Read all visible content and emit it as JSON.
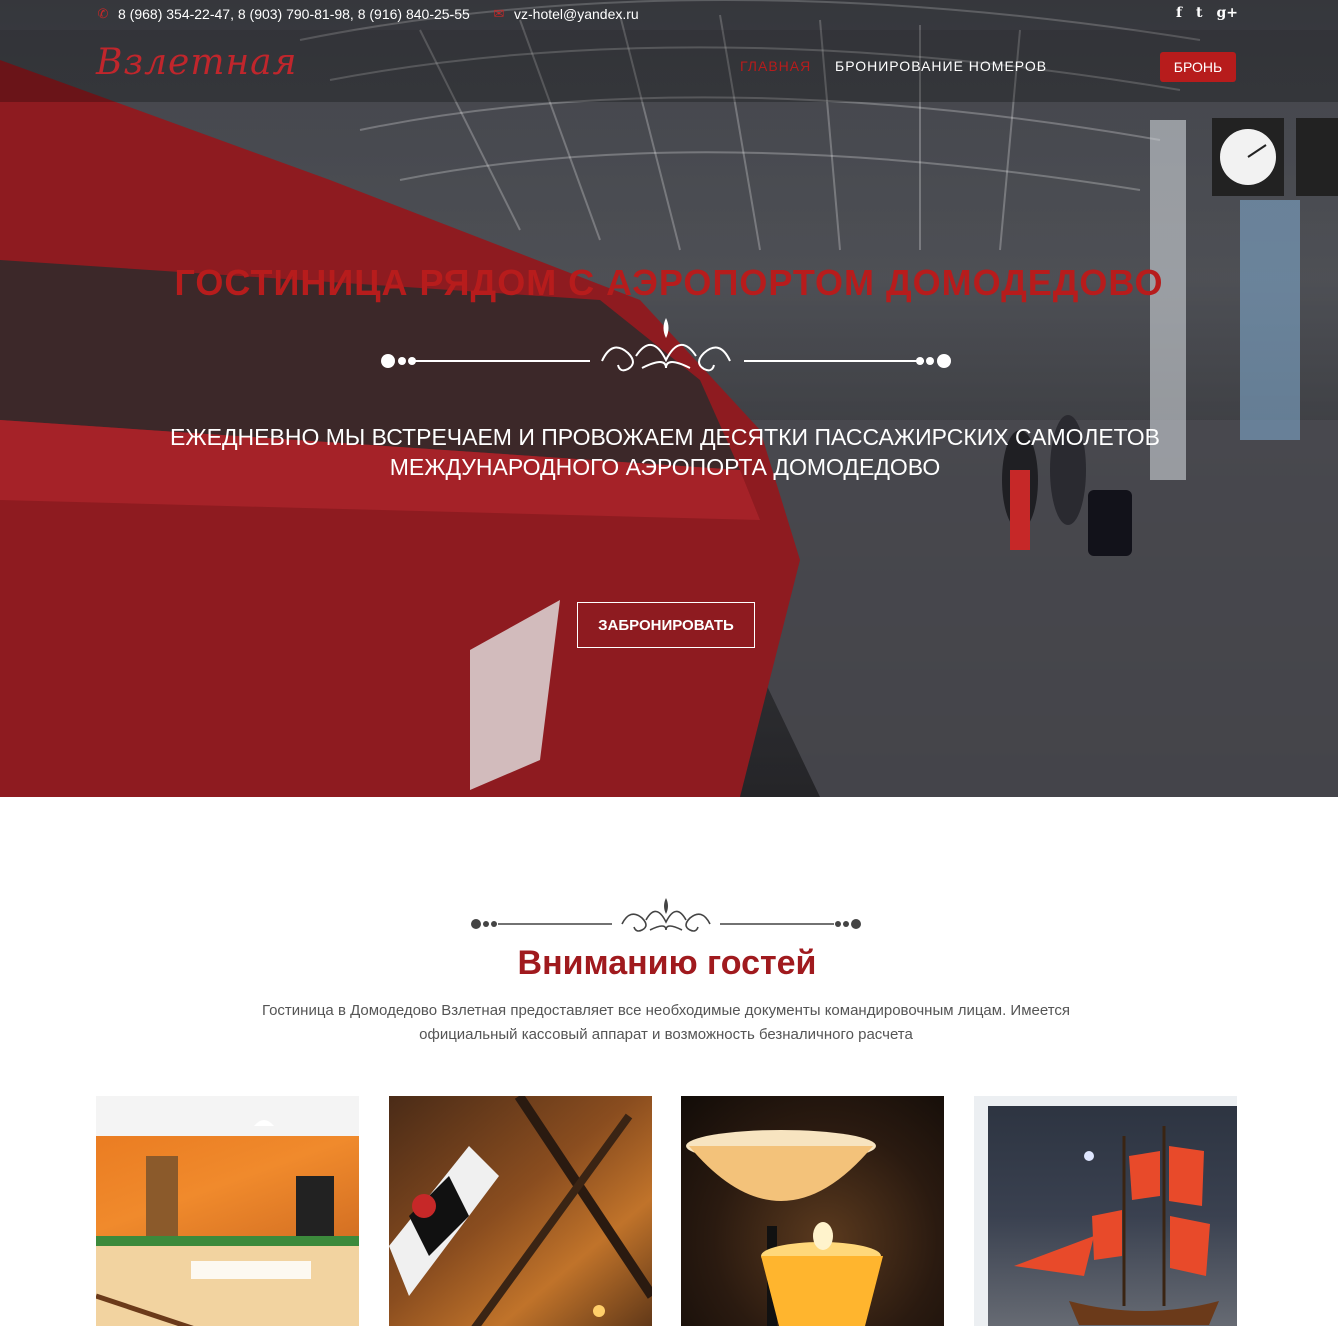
{
  "topbar": {
    "phones": "8 (968) 354-22-47, 8 (903) 790-81-98, 8 (916) 840-25-55",
    "email": "vz-hotel@yandex.ru",
    "social": [
      "f",
      "t",
      "g+"
    ]
  },
  "nav": {
    "logo": "Взлетная",
    "items": [
      "ГЛАВНАЯ",
      "БРОНИРОВАНИЕ НОМЕРОВ"
    ],
    "book_button": "БРОНЬ"
  },
  "hero": {
    "title": "ГОСТИНИЦА РЯДОМ С АЭРОПОРТОМ ДОМОДЕДОВО",
    "subtitle_line1": "ЕЖЕДНЕВНО МЫ ВСТРЕЧАЕМ И ПРОВОЖАЕМ ДЕСЯТКИ ПАССАЖИРСКИХ САМОЛЕТОВ",
    "subtitle_line2": "МЕЖДУНАРОДНОГО АЭРОПОРТА ДОМОДЕДОВО",
    "cta": "ЗАБРОНИРОВАТЬ"
  },
  "guests": {
    "title": "Вниманию гостей",
    "text": "Гостиница в Домодедово Взлетная предоставляет все необходимые документы командировочным лицам. Имеется официальный кассовый аппарат и возможность безналичного расчета"
  },
  "colors": {
    "brand": "#b71c1c",
    "heading": "#a01a1e"
  },
  "icons": [
    "phone-icon",
    "envelope-icon",
    "facebook-icon",
    "twitter-icon",
    "google-plus-icon"
  ]
}
